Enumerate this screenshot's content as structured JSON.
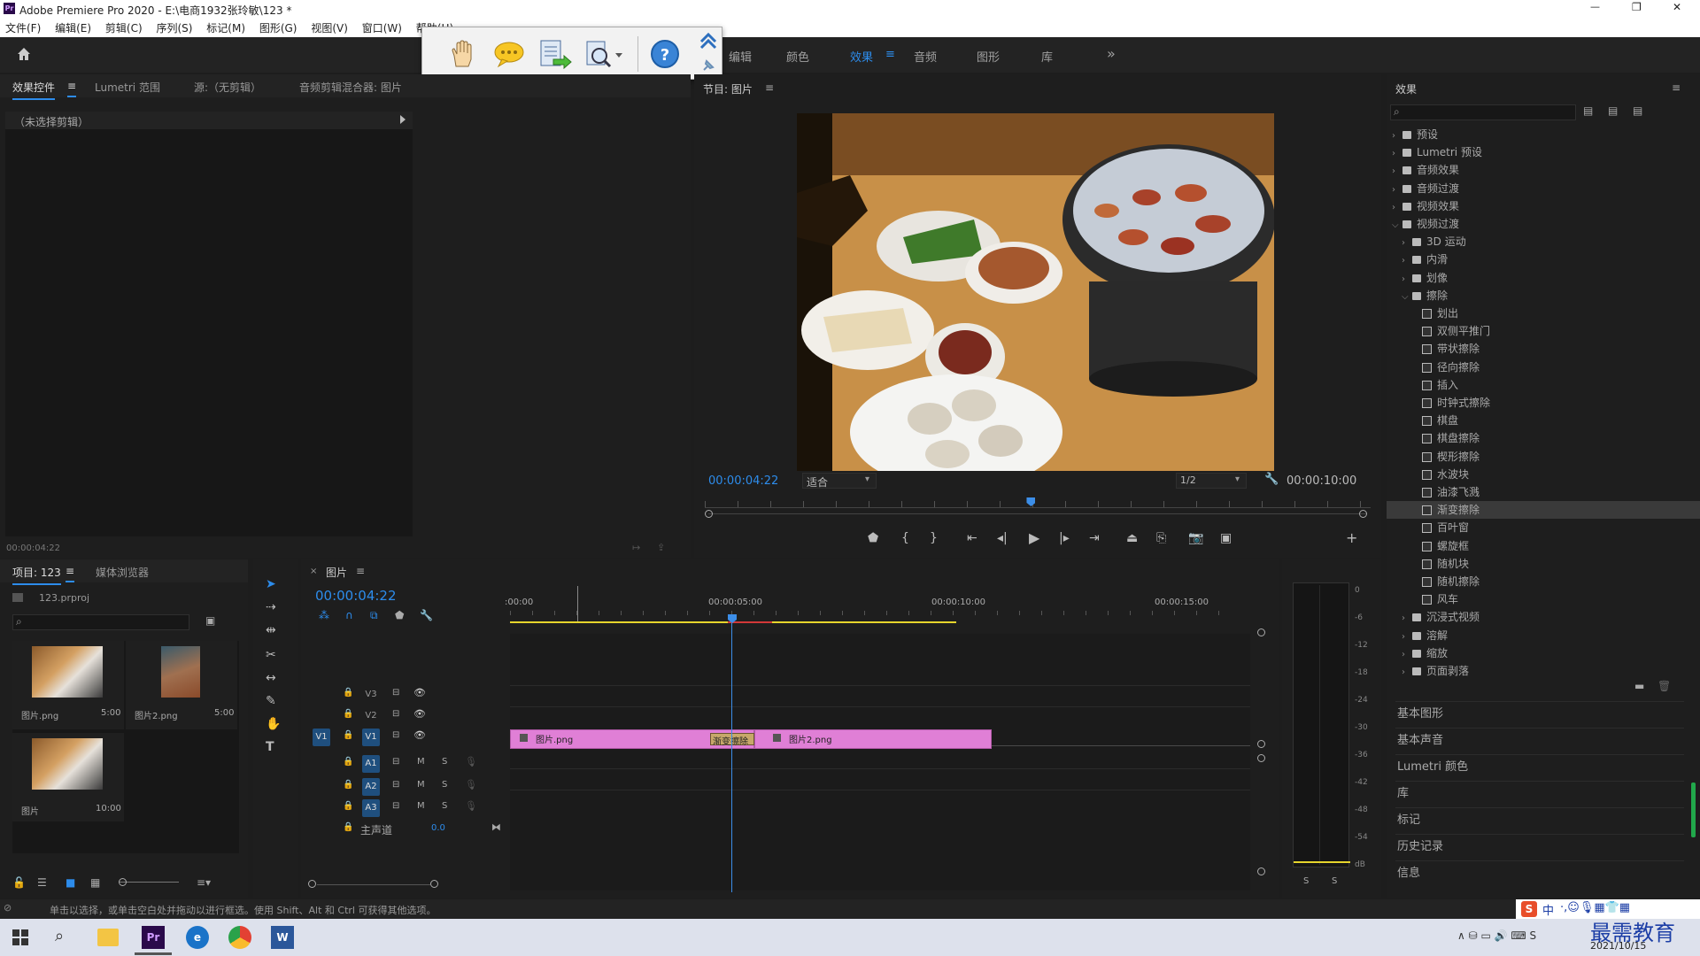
{
  "window": {
    "title": "Adobe Premiere Pro 2020 - E:\\电商1932张玲敏\\123 *",
    "controls": {
      "minimize": "—",
      "maximize": "❐",
      "close": "✕"
    }
  },
  "menu": [
    "文件(F)",
    "编辑(E)",
    "剪辑(C)",
    "序列(S)",
    "标记(M)",
    "图形(G)",
    "视图(V)",
    "窗口(W)",
    "帮助(H)"
  ],
  "workspaces": [
    {
      "label": "编辑",
      "active": false
    },
    {
      "label": "颜色",
      "active": false
    },
    {
      "label": "效果",
      "active": true
    },
    {
      "label": "音频",
      "active": false
    },
    {
      "label": "图形",
      "active": false
    },
    {
      "label": "库",
      "active": false
    }
  ],
  "workspace_more": "»",
  "source_panel": {
    "tabs": [
      "效果控件",
      "Lumetri 范围",
      "源:（无剪辑）",
      "音频剪辑混合器: 图片"
    ],
    "no_clip": "（未选择剪辑）",
    "timecode": "00:00:04:22"
  },
  "program_monitor": {
    "title": "节目: 图片",
    "timecode_current": "00:00:04:22",
    "fit": "适合",
    "resolution": "1/2",
    "timecode_duration": "00:00:10:00",
    "playhead_fraction": 0.49
  },
  "effects_panel": {
    "title": "效果",
    "search_placeholder": "",
    "tree": [
      {
        "label": "预设",
        "level": 0,
        "type": "folder",
        "open": false
      },
      {
        "label": "Lumetri 预设",
        "level": 0,
        "type": "folder",
        "open": false
      },
      {
        "label": "音频效果",
        "level": 0,
        "type": "folder",
        "open": false
      },
      {
        "label": "音频过渡",
        "level": 0,
        "type": "folder",
        "open": false
      },
      {
        "label": "视频效果",
        "level": 0,
        "type": "folder",
        "open": false
      },
      {
        "label": "视频过渡",
        "level": 0,
        "type": "folder",
        "open": true
      },
      {
        "label": "3D 运动",
        "level": 1,
        "type": "folder",
        "open": false
      },
      {
        "label": "内滑",
        "level": 1,
        "type": "folder",
        "open": false
      },
      {
        "label": "划像",
        "level": 1,
        "type": "folder",
        "open": false
      },
      {
        "label": "擦除",
        "level": 1,
        "type": "folder",
        "open": true
      },
      {
        "label": "划出",
        "level": 2,
        "type": "fx"
      },
      {
        "label": "双侧平推门",
        "level": 2,
        "type": "fx"
      },
      {
        "label": "带状擦除",
        "level": 2,
        "type": "fx"
      },
      {
        "label": "径向擦除",
        "level": 2,
        "type": "fx"
      },
      {
        "label": "插入",
        "level": 2,
        "type": "fx"
      },
      {
        "label": "时钟式擦除",
        "level": 2,
        "type": "fx"
      },
      {
        "label": "棋盘",
        "level": 2,
        "type": "fx"
      },
      {
        "label": "棋盘擦除",
        "level": 2,
        "type": "fx"
      },
      {
        "label": "楔形擦除",
        "level": 2,
        "type": "fx"
      },
      {
        "label": "水波块",
        "level": 2,
        "type": "fx"
      },
      {
        "label": "油漆飞溅",
        "level": 2,
        "type": "fx"
      },
      {
        "label": "渐变擦除",
        "level": 2,
        "type": "fx",
        "selected": true
      },
      {
        "label": "百叶窗",
        "level": 2,
        "type": "fx"
      },
      {
        "label": "螺旋框",
        "level": 2,
        "type": "fx"
      },
      {
        "label": "随机块",
        "level": 2,
        "type": "fx"
      },
      {
        "label": "随机擦除",
        "level": 2,
        "type": "fx"
      },
      {
        "label": "风车",
        "level": 2,
        "type": "fx"
      },
      {
        "label": "沉浸式视频",
        "level": 1,
        "type": "folder",
        "open": false
      },
      {
        "label": "溶解",
        "level": 1,
        "type": "folder",
        "open": false
      },
      {
        "label": "缩放",
        "level": 1,
        "type": "folder",
        "open": false
      },
      {
        "label": "页面剥落",
        "level": 1,
        "type": "folder",
        "open": false
      }
    ],
    "collapsed_panels": [
      "基本图形",
      "基本声音",
      "Lumetri 颜色",
      "库",
      "标记",
      "历史记录",
      "信息"
    ]
  },
  "project_panel": {
    "tabs": [
      "项目: 123",
      "媒体浏览器"
    ],
    "file": "123.prproj",
    "items": [
      {
        "name": "图片.png",
        "duration": "5:00"
      },
      {
        "name": "图片2.png",
        "duration": "5:00"
      },
      {
        "name": "图片",
        "duration": "10:00"
      }
    ]
  },
  "timeline": {
    "tab": "图片",
    "timecode": "00:00:04:22",
    "ruler": [
      ":00:00",
      "00:00:05:00",
      "00:00:10:00",
      "00:00:15:00"
    ],
    "tracks_video": [
      "V3",
      "V2",
      "V1"
    ],
    "tracks_audio": [
      "A1",
      "A2",
      "A3"
    ],
    "master": "主声道",
    "master_value": "0.0",
    "clips": [
      {
        "name": "图片.png",
        "track": "V1"
      },
      {
        "name": "图片2.png",
        "track": "V1"
      }
    ],
    "transition": "渐变擦除"
  },
  "audio_meter": {
    "scale": [
      "0",
      "-6",
      "-12",
      "-18",
      "-24",
      "-30",
      "-36",
      "-42",
      "-48",
      "-54",
      "dB"
    ],
    "solo": [
      "S",
      "S"
    ]
  },
  "status_bar": "单击以选择，或单击空白处并拖动以进行框选。使用 Shift、Alt 和 Ctrl 可获得其他选项。",
  "taskbar": {
    "date": "2021/10/15",
    "watermark": "最需教育",
    "ime": "中"
  },
  "colors": {
    "accent": "#2d8ceb",
    "clip": "#e07fd6",
    "timeline_bar": "#e6d52c",
    "playhead": "#3c8ee8"
  }
}
